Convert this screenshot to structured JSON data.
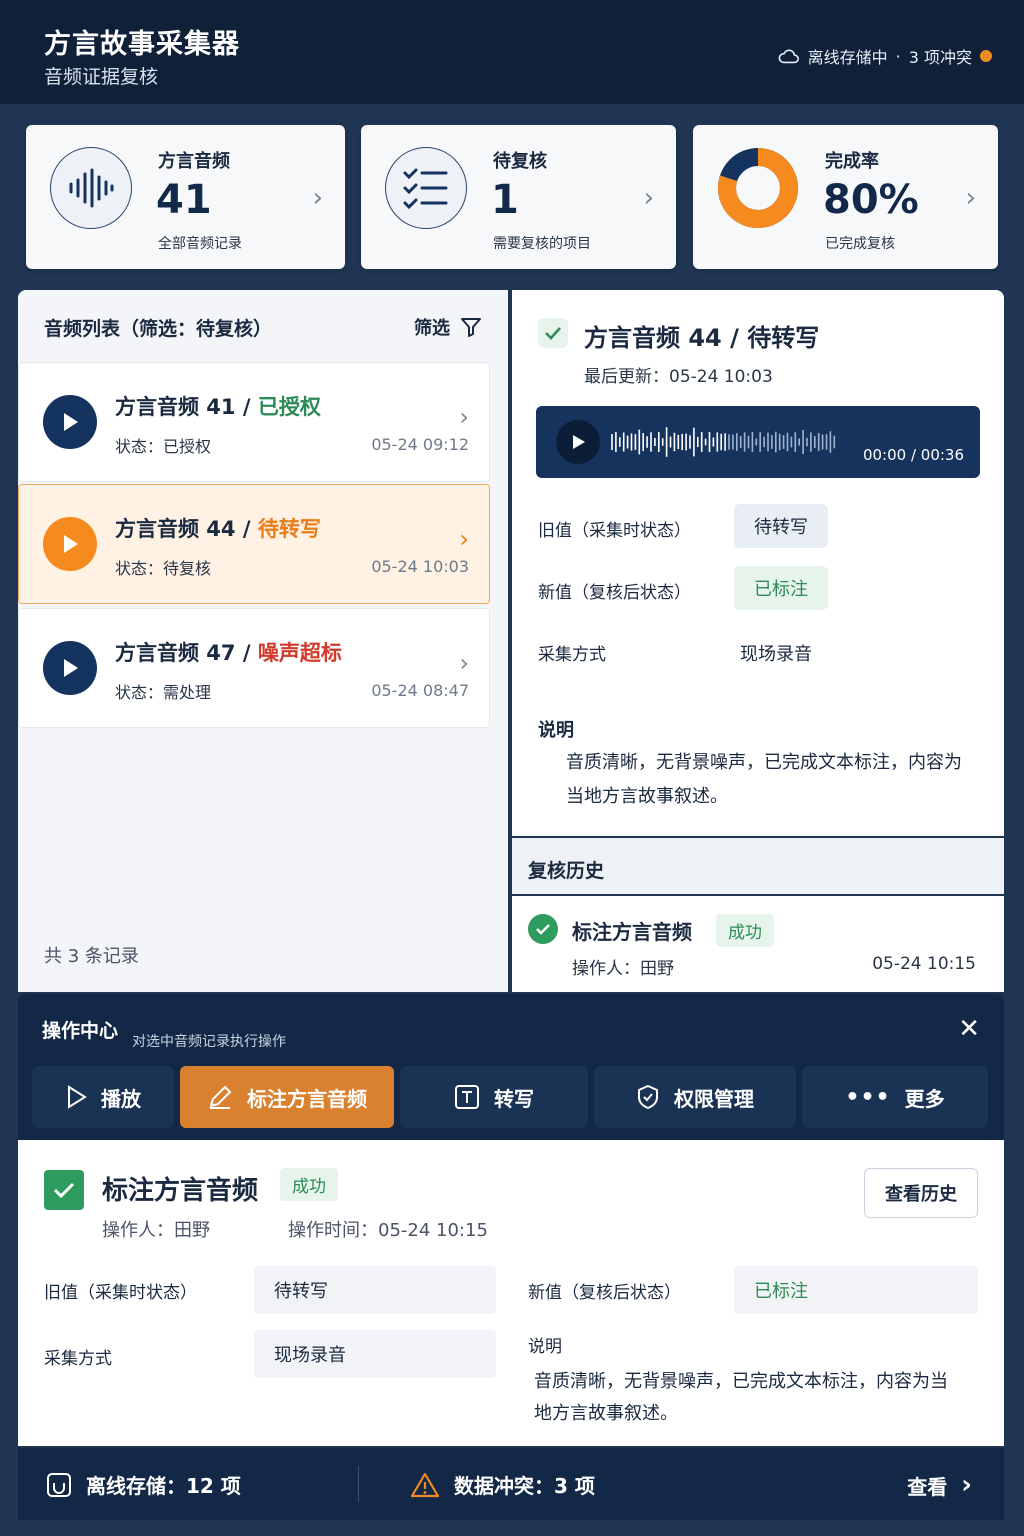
{
  "app": {
    "title": "方言故事采集器",
    "subtitle": "音频证据复核"
  },
  "sync": {
    "status": "离线存储中",
    "separator": "·",
    "conflicts": "3 项冲突",
    "dot_color": "#f08a24"
  },
  "stats": [
    {
      "label": "方言音频",
      "value": "41",
      "desc": "全部音频记录",
      "icon": "waveform-icon"
    },
    {
      "label": "待复核",
      "value": "1",
      "desc": "需要复核的项目",
      "icon": "checklist-icon"
    },
    {
      "label": "完成率",
      "value": "80%",
      "desc": "已完成复核",
      "icon": "donut-chart-icon",
      "progress": 0.8
    }
  ],
  "list": {
    "heading": "音频列表（筛选：待复核）",
    "filter_label": "筛选",
    "items": [
      {
        "title": "方言音频 41 / ",
        "tag": "已授权",
        "state": "状态：已授权",
        "time": "05-24 09:12"
      },
      {
        "title": "方言音频 44 / ",
        "tag": "待转写",
        "state": "状态：待复核",
        "time": "05-24 10:03"
      },
      {
        "title": "方言音频 47 / ",
        "tag": "噪声超标",
        "state": "状态：需处理",
        "time": "05-24 08:47"
      }
    ],
    "count": "共 3 条记录"
  },
  "detail": {
    "title": "方言音频 44 / 待转写",
    "updated": "最后更新：05-24 10:03",
    "player_time": "00:00 / 00:36",
    "old_label": "旧值（采集时状态）",
    "old_value": "待转写",
    "new_label": "新值（复核后状态）",
    "new_value": "已标注",
    "method_label": "采集方式",
    "method_value": "现场录音",
    "note_label": "说明",
    "note_text": "音质清晰，无背景噪声，已完成文本标注，内容为当地方言故事叙述。"
  },
  "history": {
    "heading": "复核历史",
    "item_title": "标注方言音频",
    "item_badge": "成功",
    "item_operator": "操作人：田野",
    "item_time": "05-24 10:15"
  },
  "op_center": {
    "title": "操作中心",
    "subtitle": "对选中音频记录执行操作",
    "tabs": [
      "播放",
      "标注方言音频",
      "转写",
      "权限管理",
      "更多"
    ]
  },
  "result": {
    "title": "标注方言音频",
    "badge": "成功",
    "operator": "操作人：田野",
    "time": "操作时间：05-24 10:15",
    "history_button": "查看历史",
    "old_label": "旧值（采集时状态）",
    "old_value": "待转写",
    "new_label": "新值（复核后状态）",
    "new_value": "已标注",
    "method_label": "采集方式",
    "method_value": "现场录音",
    "note_label": "说明",
    "note_text": "音质清晰，无背景噪声，已完成文本标注，内容为当地方言故事叙述。"
  },
  "footer": {
    "offline": "离线存储：12 项",
    "conflict": "数据冲突：3 项",
    "view": "查看"
  }
}
